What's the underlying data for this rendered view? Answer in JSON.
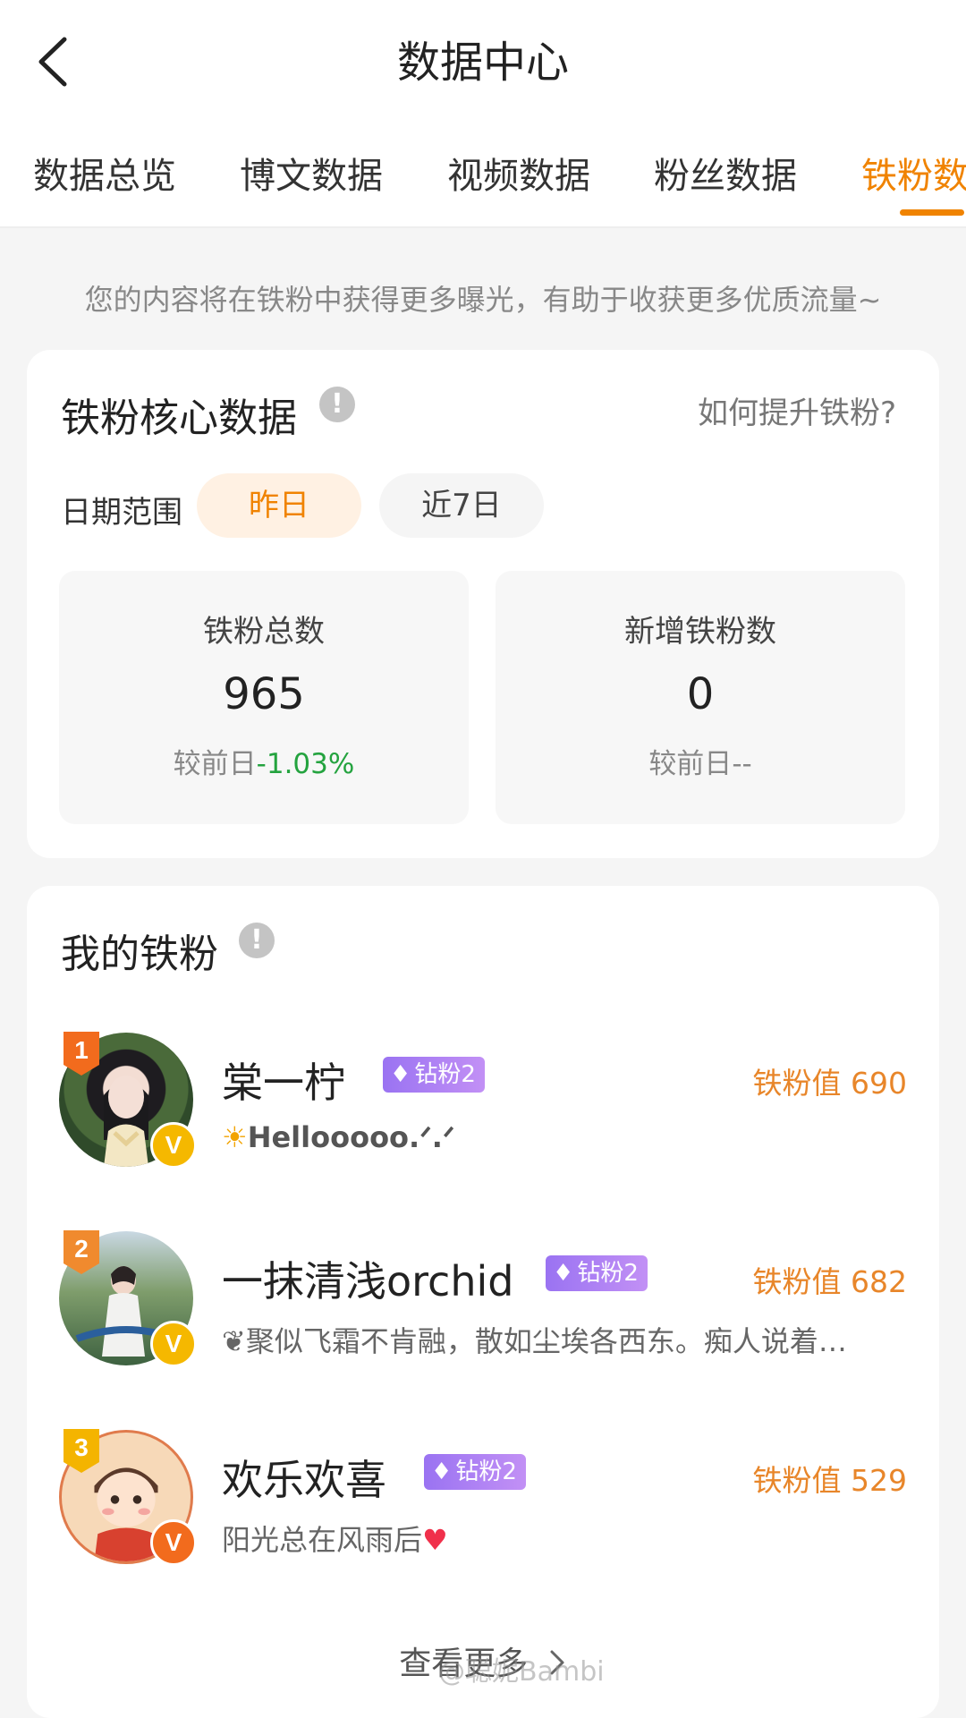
{
  "header": {
    "title": "数据中心"
  },
  "tabs": [
    "数据总览",
    "博文数据",
    "视频数据",
    "粉丝数据",
    "铁粉数据"
  ],
  "active_tab_index": 4,
  "notice": "您的内容将在铁粉中获得更多曝光，有助于收获更多优质流量~",
  "core": {
    "title": "铁粉核心数据",
    "help_link": "如何提升铁粉?",
    "date_label": "日期范围",
    "date_options": [
      "昨日",
      "近7日"
    ],
    "selected_date": "昨日",
    "stats": [
      {
        "label": "铁粉总数",
        "value": "965",
        "compare_prefix": "较前日",
        "change": "-1.03%"
      },
      {
        "label": "新增铁粉数",
        "value": "0",
        "compare_prefix": "较前日",
        "change": "--"
      }
    ]
  },
  "my_fans": {
    "title": "我的铁粉",
    "fans": [
      {
        "rank": "1",
        "name": "棠一柠",
        "level": "钻粉2",
        "value_text": "铁粉值 690",
        "bio": "Hellooooo.ᐟ.ᐟ",
        "bio_emoji": "☀"
      },
      {
        "rank": "2",
        "name": "一抹清浅orchid",
        "level": "钻粉2",
        "value_text": "铁粉值 682",
        "bio": "聚似飞霜不肯融，散如尘埃各西东。痴人说着…",
        "bio_emoji": "❦"
      },
      {
        "rank": "3",
        "name": "欢乐欢喜",
        "level": "钻粉2",
        "value_text": "铁粉值 529",
        "bio": "阳光总在风雨后",
        "bio_emoji": "♥"
      }
    ],
    "see_more": "查看更多"
  },
  "watermark": "@聪妮Bambi",
  "colors": {
    "accent": "#f08300",
    "fan_value": "#e8862a",
    "positive_change_green": "#24a33f",
    "level_badge_purple": "#a47bf3",
    "verified_yellow": "#f5b800",
    "verified_orange": "#f26b1d"
  },
  "icons": [
    "back-arrow-icon",
    "info-icon",
    "gem-icon",
    "verified-v-icon",
    "chevron-right-icon"
  ]
}
